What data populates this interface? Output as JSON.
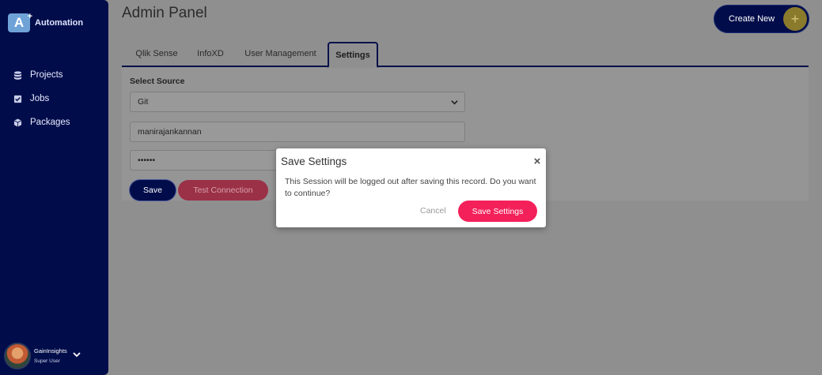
{
  "app": {
    "name": "Automation",
    "logo_glyph": "A"
  },
  "sidebar": {
    "items": [
      {
        "label": "Projects",
        "icon": "database-icon"
      },
      {
        "label": "Jobs",
        "icon": "checkbox-icon"
      },
      {
        "label": "Packages",
        "icon": "cube-icon"
      }
    ],
    "user": {
      "name": "GainInsights",
      "role": "Super User"
    }
  },
  "header": {
    "title": "Admin Panel",
    "create_new_label": "Create New",
    "create_new_icon": "+"
  },
  "tabs": [
    {
      "label": "Qlik Sense",
      "active": false
    },
    {
      "label": "InfoXD",
      "active": false
    },
    {
      "label": "User Management",
      "active": false
    },
    {
      "label": "Settings",
      "active": true
    }
  ],
  "form": {
    "source_label": "Select Source",
    "source_value": "Git",
    "username_value": "manirajankannan",
    "password_value": "••••••",
    "save_label": "Save",
    "test_label": "Test Connection"
  },
  "modal": {
    "title": "Save Settings",
    "close_glyph": "×",
    "message": "This Session will be logged out after saving this record. Do you want to continue?",
    "cancel_label": "Cancel",
    "confirm_label": "Save Settings"
  },
  "colors": {
    "navy": "#010d4a",
    "accent": "#f4205a",
    "gold": "#8a7a2c"
  }
}
